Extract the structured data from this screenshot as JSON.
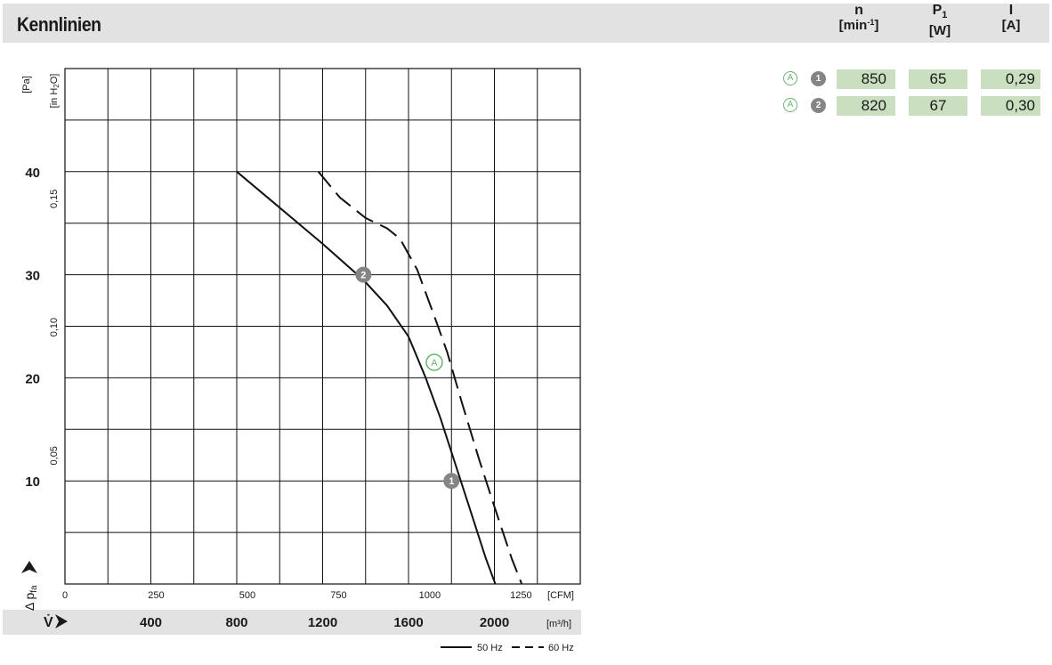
{
  "header": {
    "title": "Kennlinien",
    "columns": [
      {
        "symbol": "n",
        "sub": "",
        "unit_pre": "[min",
        "unit_sup": "-1",
        "unit_post": "]"
      },
      {
        "symbol": "P",
        "sub": "1",
        "unit_pre": "[W]",
        "unit_sup": "",
        "unit_post": ""
      },
      {
        "symbol": "I",
        "sub": "",
        "unit_pre": "[A]",
        "unit_sup": "",
        "unit_post": ""
      }
    ]
  },
  "table": {
    "rows": [
      {
        "letter": "A",
        "point": "1",
        "n": "850",
        "p1": "65",
        "i": "0,29"
      },
      {
        "letter": "A",
        "point": "2",
        "n": "820",
        "p1": "67",
        "i": "0,30"
      }
    ]
  },
  "chart_data": {
    "type": "line",
    "x_unit_bottom": "[m³/h]",
    "x_ticks_bottom": [
      "400",
      "800",
      "1200",
      "1600",
      "2000"
    ],
    "x_unit_top": "[CFM]",
    "x_ticks_top": [
      "0",
      "250",
      "500",
      "750",
      "1000",
      "1250"
    ],
    "y_unit_left": "[Pa]",
    "y_ticks_left": [
      "10",
      "20",
      "30",
      "40"
    ],
    "y_unit_right": "[in H2O]",
    "y_ticks_right": [
      "0,05",
      "0,10",
      "0,15"
    ],
    "xlabel_symbol": "V̇",
    "ylabel_symbol": "Δ p",
    "ylabel_sub": "fa",
    "xlim": [
      0,
      2400
    ],
    "ylim": [
      0,
      50
    ],
    "series": [
      {
        "name": "50 Hz",
        "style": "solid",
        "x": [
          800,
          1000,
          1200,
          1390,
          1500,
          1600,
          1680,
          1750,
          1820,
          1890,
          1960,
          2040
        ],
        "y": [
          40,
          36.5,
          33,
          29.5,
          27,
          24,
          20,
          16,
          11.5,
          7,
          2.5,
          -2
        ]
      },
      {
        "name": "60 Hz",
        "style": "dashed",
        "x": [
          1180,
          1280,
          1400,
          1500,
          1560,
          1640,
          1720,
          1780,
          1850,
          1930,
          2000,
          2080,
          2165
        ],
        "y": [
          40,
          37.5,
          35.5,
          34.5,
          33.5,
          30.5,
          26,
          22.5,
          17.5,
          12,
          7.5,
          2.5,
          -2
        ]
      }
    ],
    "operating_points": [
      {
        "label": "1",
        "x": 1800,
        "y": 10
      },
      {
        "label": "2",
        "x": 1390,
        "y": 30
      }
    ],
    "annotation": {
      "label": "A",
      "x": 1720,
      "y": 21.5
    },
    "legend": [
      "50 Hz",
      "60 Hz"
    ],
    "grid": true,
    "legend_position": "bottom-right"
  }
}
